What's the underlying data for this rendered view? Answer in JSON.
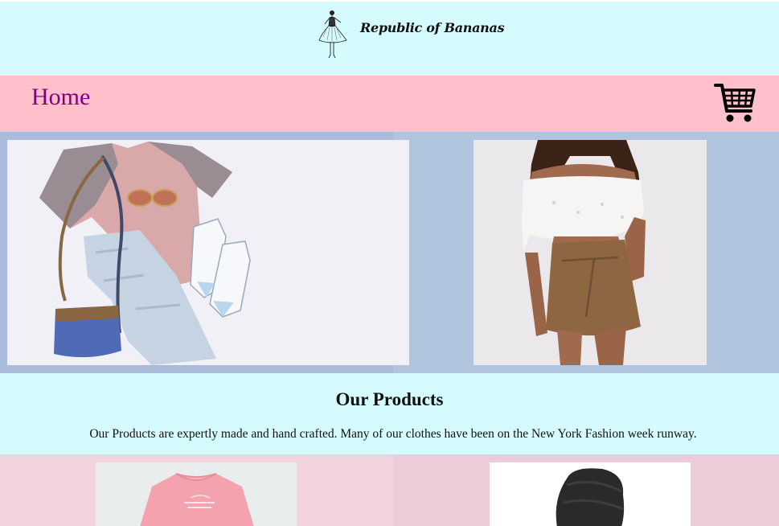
{
  "header": {
    "brand_name": "Republic of Bananas",
    "logo_icon": "fashion-sketch-icon",
    "background": "#d6fbfe"
  },
  "nav": {
    "home_label": "Home",
    "cart_icon": "shopping-cart-icon",
    "background": "#ffc0cb",
    "link_color": "#800080"
  },
  "hero": {
    "background": "#b0c4de",
    "images": [
      {
        "name": "flat-lay-outfit-photo",
        "subject": "pink t-shirt, jeans, sneakers, sunglasses and blue bag"
      },
      {
        "name": "model-outfit-photo",
        "subject": "off-shoulder white top and suede skirt"
      }
    ]
  },
  "products": {
    "heading": "Our Products",
    "description": "Our Products are expertly made and hand crafted. Many of our clothes have been on the New York Fashion week runway.",
    "background": "#d6fbfe"
  },
  "product_grid": {
    "background": "#eecfdc",
    "items": [
      {
        "name": "pink-sweatshirt-photo"
      },
      {
        "name": "black-beanie-photo"
      }
    ]
  }
}
